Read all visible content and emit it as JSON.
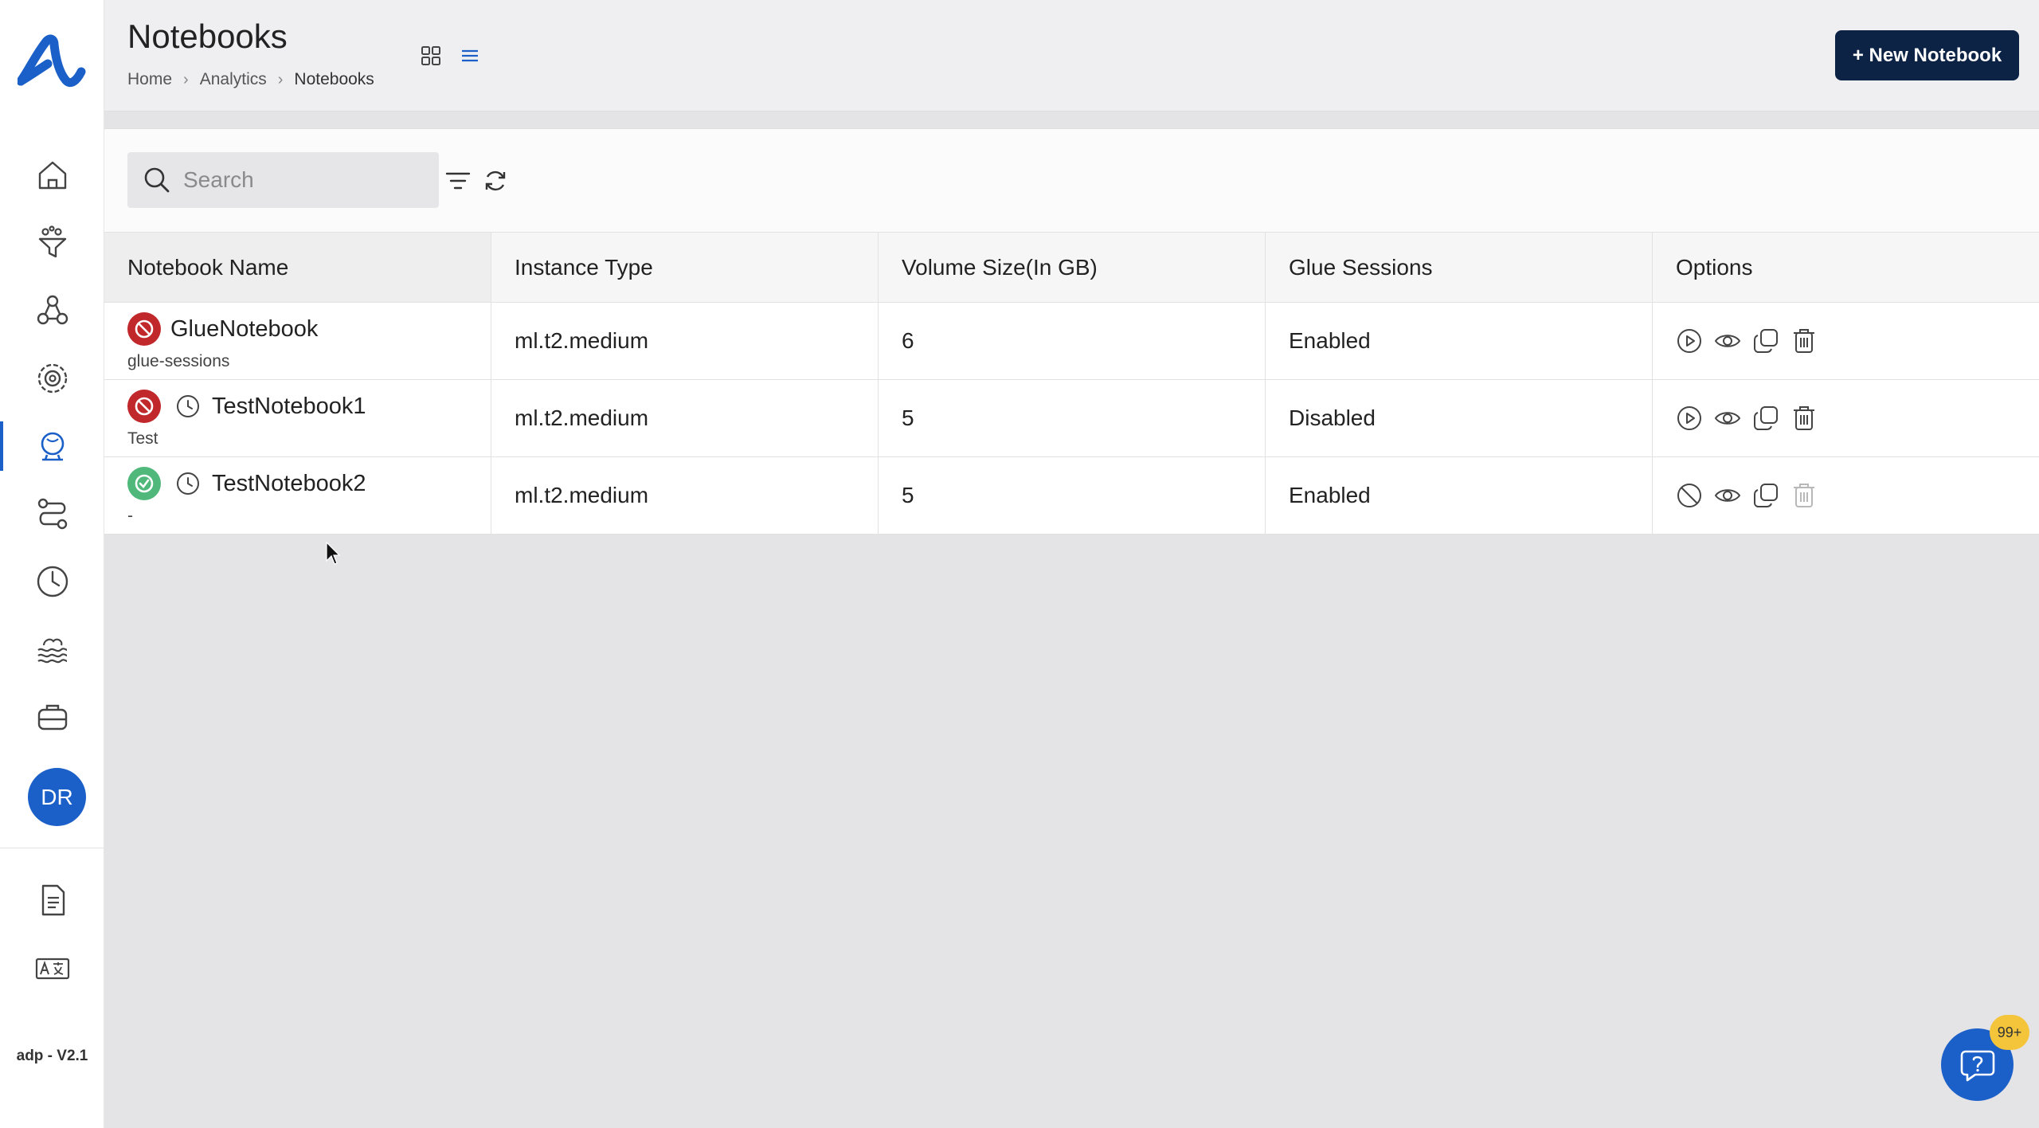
{
  "sidebar": {
    "avatar_initials": "DR",
    "version": "adp - V2.1",
    "items": [
      {
        "icon": "home-icon"
      },
      {
        "icon": "filter-funnel-icon"
      },
      {
        "icon": "network-nodes-icon"
      },
      {
        "icon": "settings-gear-icon"
      },
      {
        "icon": "notebook-globe-icon",
        "active": true
      },
      {
        "icon": "pipeline-icon"
      },
      {
        "icon": "clock-icon"
      },
      {
        "icon": "data-lake-icon"
      },
      {
        "icon": "storage-icon"
      }
    ],
    "bottom_items": [
      {
        "icon": "document-icon"
      },
      {
        "icon": "translate-icon"
      }
    ]
  },
  "header": {
    "title": "Notebooks",
    "breadcrumb": [
      "Home",
      "Analytics",
      "Notebooks"
    ],
    "new_button": "+ New Notebook"
  },
  "toolbar": {
    "search_placeholder": "Search"
  },
  "table": {
    "columns": [
      "Notebook Name",
      "Instance Type",
      "Volume Size(In GB)",
      "Glue Sessions",
      "Options"
    ],
    "rows": [
      {
        "name": "GlueNotebook",
        "sub": "glue-sessions",
        "status": "stopped",
        "scheduled": false,
        "instance": "ml.t2.medium",
        "volume": "6",
        "glue": "Enabled",
        "running": false
      },
      {
        "name": "TestNotebook1",
        "sub": "Test",
        "status": "stopped",
        "scheduled": true,
        "instance": "ml.t2.medium",
        "volume": "5",
        "glue": "Disabled",
        "running": false
      },
      {
        "name": "TestNotebook2",
        "sub": "-",
        "status": "running",
        "scheduled": true,
        "instance": "ml.t2.medium",
        "volume": "5",
        "glue": "Enabled",
        "running": true
      }
    ]
  },
  "help": {
    "badge": "99+"
  },
  "colors": {
    "accent": "#1b5fc8",
    "primary_button": "#0d2346",
    "stopped": "#c0282b",
    "running": "#4fb87a",
    "badge": "#f4c53a"
  }
}
